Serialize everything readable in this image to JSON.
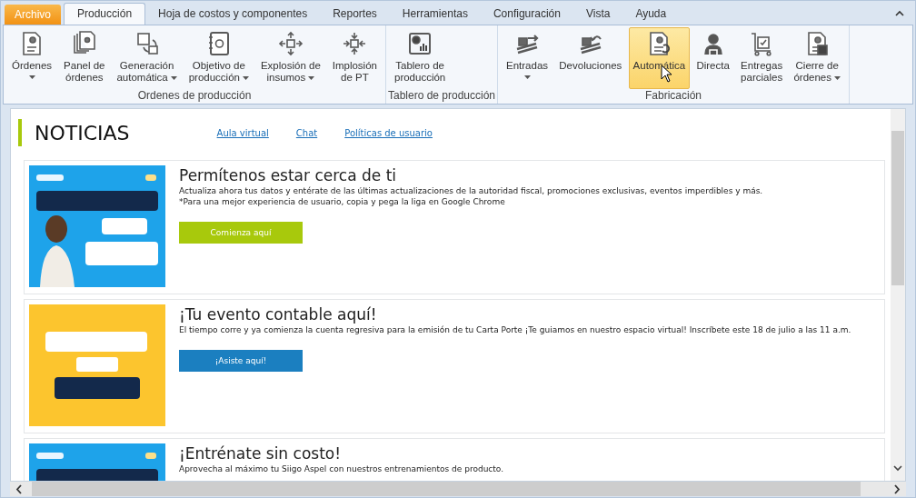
{
  "tabs": [
    {
      "label": "Archivo",
      "kind": "app",
      "selected": false
    },
    {
      "label": "Producción",
      "kind": "tab",
      "selected": true
    },
    {
      "label": "Hoja de costos y componentes",
      "kind": "tab",
      "selected": false
    },
    {
      "label": "Reportes",
      "kind": "tab",
      "selected": false
    },
    {
      "label": "Herramientas",
      "kind": "tab",
      "selected": false
    },
    {
      "label": "Configuración",
      "kind": "tab",
      "selected": false
    },
    {
      "label": "Vista",
      "kind": "tab",
      "selected": false
    },
    {
      "label": "Ayuda",
      "kind": "tab",
      "selected": false
    }
  ],
  "ribbon": {
    "groups": [
      {
        "label": "Ordenes de producción",
        "buttons": [
          {
            "lines": [
              "Órdenes"
            ],
            "dropdown": true,
            "selected": false
          },
          {
            "lines": [
              "Panel de",
              "órdenes"
            ],
            "dropdown": false,
            "selected": false
          },
          {
            "lines": [
              "Generación",
              "automática"
            ],
            "dropdown": true,
            "selected": false
          },
          {
            "lines": [
              "Objetivo de",
              "producción"
            ],
            "dropdown": true,
            "selected": false
          },
          {
            "lines": [
              "Explosión de",
              "insumos"
            ],
            "dropdown": true,
            "selected": false
          },
          {
            "lines": [
              "Implosión",
              "de PT"
            ],
            "dropdown": false,
            "selected": false
          }
        ]
      },
      {
        "label": "Tablero de producción",
        "buttons": [
          {
            "lines": [
              "Tablero de",
              "producción"
            ],
            "dropdown": false,
            "selected": false
          }
        ]
      },
      {
        "label": "Fabricación",
        "buttons": [
          {
            "lines": [
              "Entradas"
            ],
            "dropdown": true,
            "selected": false
          },
          {
            "lines": [
              "Devoluciones"
            ],
            "dropdown": false,
            "selected": false
          },
          {
            "lines": [
              "Automática"
            ],
            "dropdown": false,
            "selected": true
          },
          {
            "lines": [
              "Directa"
            ],
            "dropdown": false,
            "selected": false
          },
          {
            "lines": [
              "Entregas",
              "parciales"
            ],
            "dropdown": false,
            "selected": false
          },
          {
            "lines": [
              "Cierre de",
              "órdenes"
            ],
            "dropdown": true,
            "selected": false
          }
        ]
      }
    ]
  },
  "news": {
    "title": "NOTICIAS",
    "links": [
      "Aula virtual",
      "Chat",
      "Políticas de usuario"
    ],
    "items": [
      {
        "title": "Permítenos estar cerca de ti",
        "text": [
          "Actualiza ahora tus datos y entérate de las últimas actualizaciones de la autoridad fiscal, promociones exclusivas, eventos imperdibles y más.",
          "*Para una mejor experiencia de usuario, copia y pega la liga en Google Chrome"
        ],
        "button": {
          "label": "Comienza aquí",
          "color": "#a8c90c"
        }
      },
      {
        "title": "¡Tu evento contable aquí!",
        "text": [
          "El tiempo corre y ya comienza la cuenta regresiva para la emisión de tu Carta Porte ¡Te guiamos en nuestro espacio virtual! Inscríbete este 18 de julio a las 11 a.m."
        ],
        "button": {
          "label": "¡Asiste aquí!",
          "color": "#1b7fc0"
        }
      },
      {
        "title": "¡Entrénate sin costo!",
        "text": [
          "Aprovecha al máximo tu Siigo Aspel con nuestros entrenamientos de producto."
        ]
      }
    ]
  }
}
